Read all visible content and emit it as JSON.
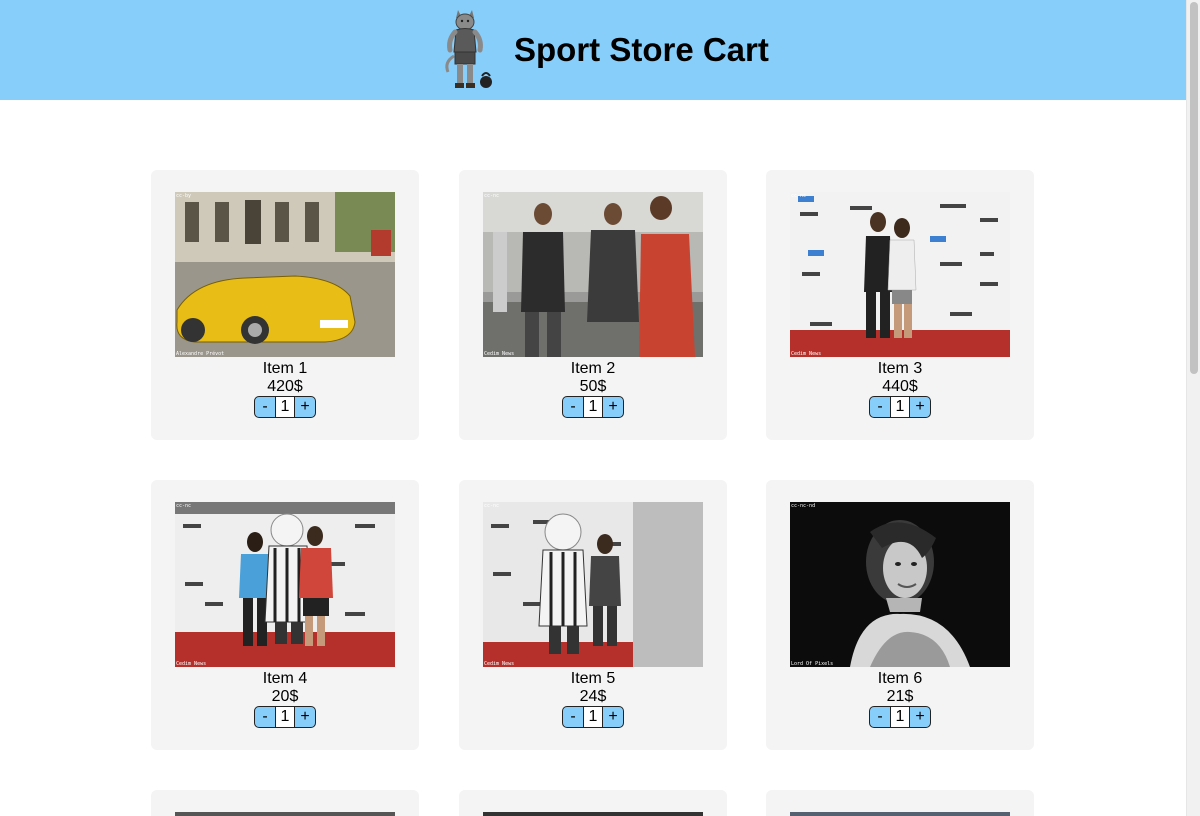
{
  "header": {
    "title": "Sport Store Cart",
    "logo_icon": "mascot-logo-icon",
    "background": "#87cefa"
  },
  "products": [
    {
      "name": "Item 1",
      "price": "420$",
      "quantity": "1",
      "minus": "-",
      "plus": "+",
      "photo": "yellow-sports-car-photo",
      "credit": "Alexandre Prévot",
      "badge": "cc-by"
    },
    {
      "name": "Item 2",
      "price": "50$",
      "quantity": "1",
      "minus": "-",
      "plus": "+",
      "photo": "young-men-in-jerseys-photo",
      "credit": "Cedim News",
      "badge": "cc-nc"
    },
    {
      "name": "Item 3",
      "price": "440$",
      "quantity": "1",
      "minus": "-",
      "plus": "+",
      "photo": "two-women-at-sponsor-wall-photo",
      "credit": "Cedim News",
      "badge": "cc-nc"
    },
    {
      "name": "Item 4",
      "price": "20$",
      "quantity": "1",
      "minus": "-",
      "plus": "+",
      "photo": "mascot-with-two-people-photo",
      "credit": "Cedim News",
      "badge": "cc-nc"
    },
    {
      "name": "Item 5",
      "price": "24$",
      "quantity": "1",
      "minus": "-",
      "plus": "+",
      "photo": "mascot-with-man-photo",
      "credit": "Cedim News",
      "badge": "cc-nc"
    },
    {
      "name": "Item 6",
      "price": "21$",
      "quantity": "1",
      "minus": "-",
      "plus": "+",
      "photo": "black-white-portrait-photo",
      "credit": "Lord Of Pixels",
      "badge": "cc-nc-nd"
    }
  ],
  "colors": {
    "accent": "#87cefa",
    "card": "#f4f4f4"
  }
}
